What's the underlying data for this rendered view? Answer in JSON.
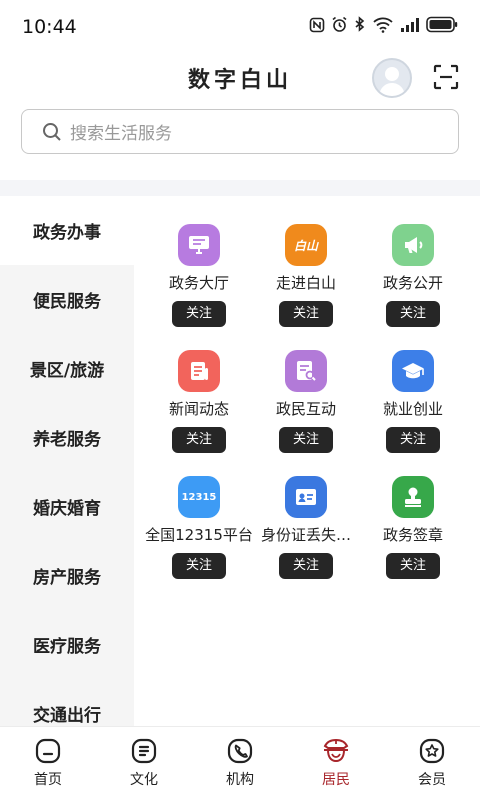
{
  "status_bar": {
    "time": "10:44"
  },
  "header": {
    "title": "数字白山"
  },
  "search": {
    "placeholder": "搜索生活服务"
  },
  "side_nav": {
    "items": [
      {
        "label": "政务办事",
        "active": true
      },
      {
        "label": "便民服务"
      },
      {
        "label": "景区/旅游"
      },
      {
        "label": "养老服务"
      },
      {
        "label": "婚庆婚育"
      },
      {
        "label": "房产服务"
      },
      {
        "label": "医疗服务"
      },
      {
        "label": "交通出行"
      }
    ]
  },
  "services": {
    "follow_label": "关注",
    "items": [
      {
        "label": "政务大厅",
        "icon": "monitor-icon",
        "color": "#b77be0"
      },
      {
        "label": "走进白山",
        "icon": "baishan-badge-icon",
        "badge_text": "白山",
        "color": "#f08a1c"
      },
      {
        "label": "政务公开",
        "icon": "megaphone-icon",
        "color": "#7fd28e"
      },
      {
        "label": "新闻动态",
        "icon": "news-icon",
        "color": "#f2645c"
      },
      {
        "label": "政民互动",
        "icon": "document-search-icon",
        "color": "#b27ad8"
      },
      {
        "label": "就业创业",
        "icon": "graduation-cap-icon",
        "color": "#3d7fe8"
      },
      {
        "label": "全国12315平台",
        "icon": "12315-badge-icon",
        "badge_text": "12315",
        "color": "#3d9bf5"
      },
      {
        "label": "身份证丢失…",
        "icon": "id-card-icon",
        "color": "#3a78e0"
      },
      {
        "label": "政务签章",
        "icon": "stamp-icon",
        "color": "#37a84a"
      }
    ]
  },
  "bottom_nav": {
    "tabs": [
      {
        "label": "首页",
        "icon": "home-icon"
      },
      {
        "label": "文化",
        "icon": "culture-icon"
      },
      {
        "label": "机构",
        "icon": "phone-icon"
      },
      {
        "label": "居民",
        "icon": "resident-icon",
        "active": true
      },
      {
        "label": "会员",
        "icon": "member-icon"
      }
    ],
    "active_color": "#a8262b"
  }
}
